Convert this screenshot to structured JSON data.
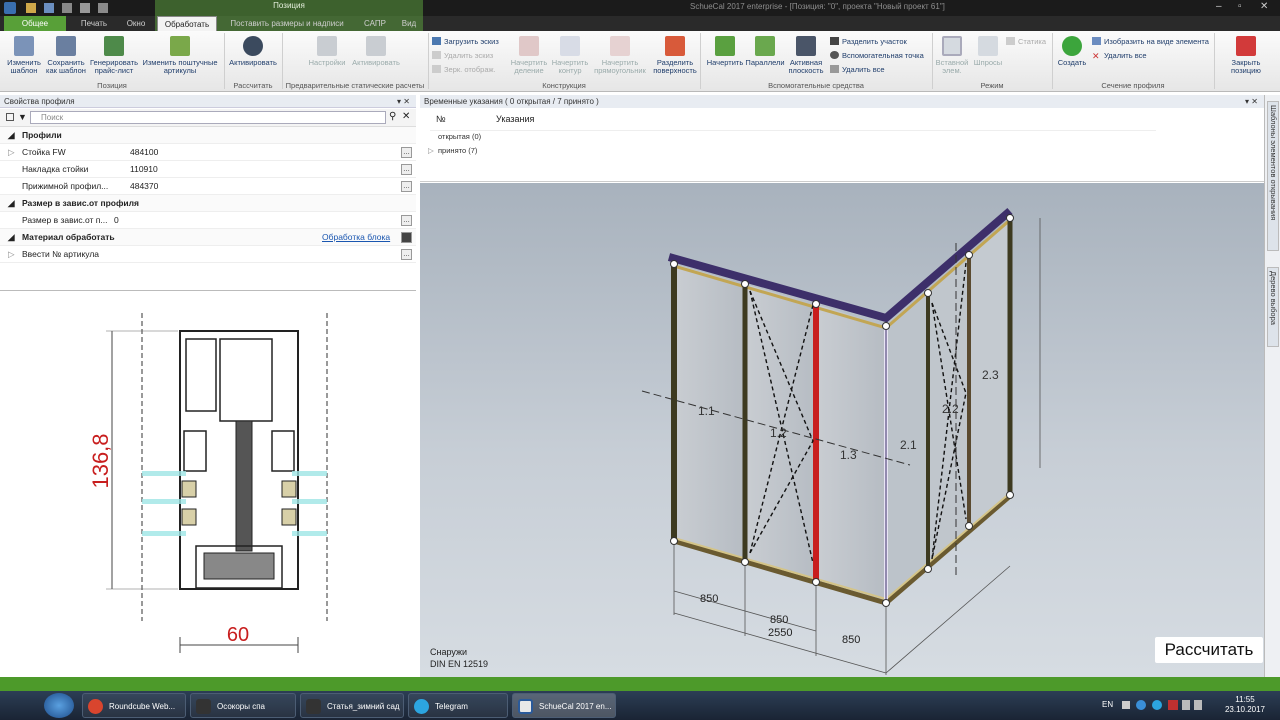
{
  "window": {
    "title": "SchueCal 2017 enterprise - [Позиция: \"0\", проекта \"Новый проект 61\"]"
  },
  "context_tab": {
    "label": "Позиция"
  },
  "tabs": [
    {
      "label": "Общее"
    },
    {
      "label": "Печать"
    },
    {
      "label": "Окно"
    },
    {
      "label": "Обработать"
    },
    {
      "label": "Поставить размеры и надписи"
    },
    {
      "label": "САПР"
    },
    {
      "label": "Вид"
    }
  ],
  "ribbon": {
    "btn_change_template": "Изменить шаблон",
    "btn_save_template": "Сохранить как шаблон",
    "btn_gen_price": "Генерировать прайс-лист",
    "btn_change_articles": "Изменить поштучные артикулы",
    "btn_activate": "Активировать",
    "btn_settings": "Настройки",
    "btn_activate2": "Активировать",
    "small_load": "Загрузить эскиз",
    "small_delete": "Удалить эскиз",
    "small_mirror": "Зерк. отображ.",
    "btn_draw_div": "Начертить деление",
    "btn_draw_contour": "Начертить контур",
    "btn_draw_rect": "Начертить прямоугольник",
    "btn_split_surface": "Разделить поверхность",
    "btn_draw": "Начертить",
    "btn_parallel": "Параллели",
    "btn_active_plane": "Активная плоскость",
    "small_split_section": "Разделить участок",
    "small_aux_point": "Вспомогательная точка",
    "small_delete_all": "Удалить все",
    "btn_insert": "Вставной элем.",
    "btn_shtulp": "Шпросы",
    "small_static": "Статика",
    "btn_create": "Создать",
    "small_show_elem": "Изобразить на виде элемента",
    "small_delete_all2": "Удалить все",
    "btn_close_position": "Закрыть позицию",
    "groups": {
      "position": "Позиция",
      "calc": "Рассчитать",
      "static": "Предварительные статические расчеты",
      "construction": "Конструкция",
      "aux": "Вспомогательные средства",
      "mode": "Режим",
      "section": "Сечение профиля"
    }
  },
  "left_panel": {
    "title": "Свойства профиля",
    "search_placeholder": "Поиск",
    "sections": [
      {
        "header": "Профили",
        "rows": [
          {
            "label": "Стойка FW",
            "value": "484100"
          },
          {
            "label": "Накладка стойки",
            "value": "110910"
          },
          {
            "label": "Прижимной профил...",
            "value": "484370"
          }
        ]
      },
      {
        "header": "Размер в завис.от профиля",
        "rows": [
          {
            "label": "Размер в завис.от п...",
            "value": "0"
          }
        ]
      },
      {
        "header": "Материал обработать",
        "link": "Обработка блока",
        "rows": [
          {
            "label": "Ввести № артикула",
            "value": ""
          }
        ]
      }
    ],
    "drawing": {
      "height_dim": "136,8",
      "width_dim": "60"
    }
  },
  "notes_panel": {
    "title": "Временные указания ( 0 открытая / 7 принято )",
    "col_no": "№",
    "col_notes": "Указания",
    "rows": [
      {
        "label": "открытая (0)"
      },
      {
        "label": "принято (7)"
      }
    ]
  },
  "viewport": {
    "view_label": "Снаружи",
    "norm": "DIN EN 12519",
    "dims": [
      "850",
      "850",
      "850",
      "2550"
    ],
    "fields": [
      "1.1",
      "1.2",
      "1.3",
      "2.1",
      "2.2",
      "2.3"
    ],
    "calc_button": "Рассчитать"
  },
  "right_side": {
    "tabs": [
      "Шаблоны элементов открывания",
      "Дерево выбора"
    ]
  },
  "taskbar": {
    "items": [
      {
        "label": "Roundcube Web..."
      },
      {
        "label": "Осокоры спа"
      },
      {
        "label": "Статья_зимний сад"
      },
      {
        "label": "Telegram"
      },
      {
        "label": "SchueCal 2017 en..."
      }
    ],
    "lang": "EN",
    "time": "11:55",
    "date": "23.10.2017"
  },
  "colors": {
    "ribbon_green": "#5a9a3c",
    "status_green": "#4d9a2a",
    "frame_purple": "#3d2f6a",
    "accent_red": "#c81e1e"
  }
}
